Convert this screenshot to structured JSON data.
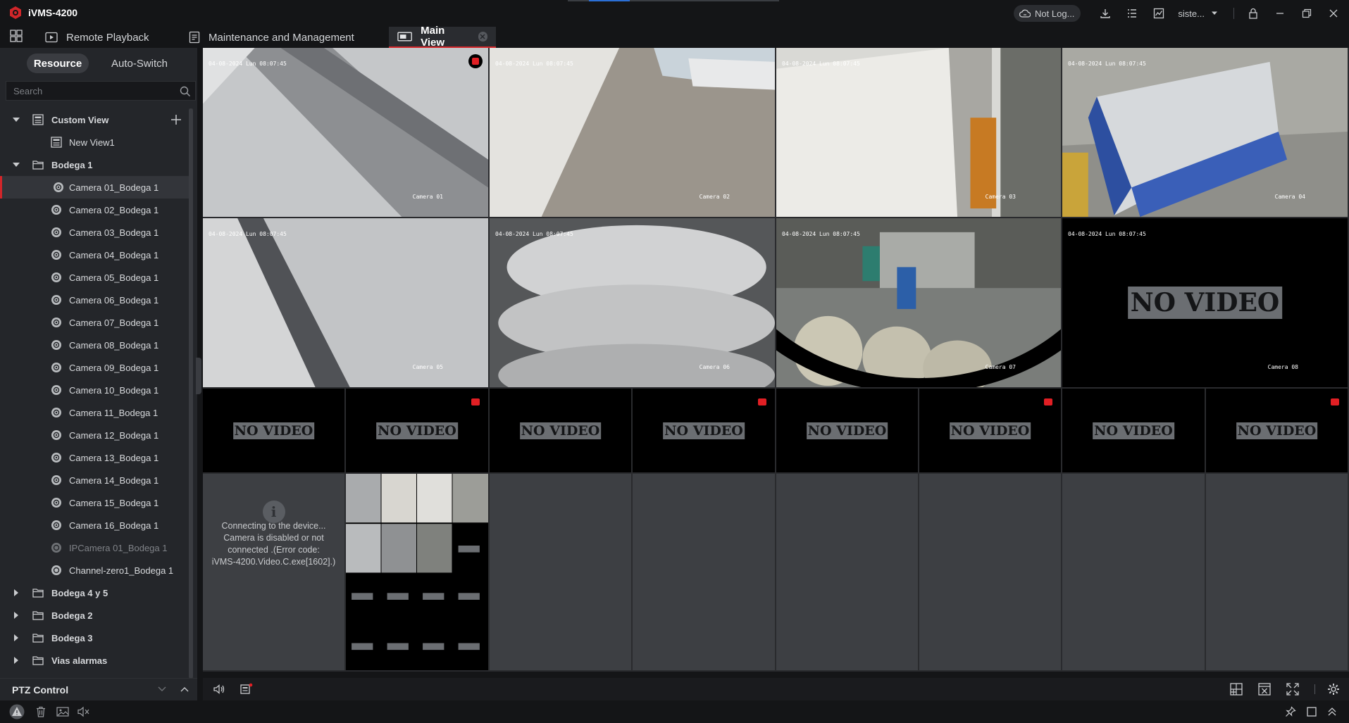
{
  "app": {
    "title": "iVMS-4200"
  },
  "titlebar": {
    "login_status": "Not Log...",
    "user": "siste..."
  },
  "tabs": [
    {
      "label": "Remote Playback"
    },
    {
      "label": "Maintenance and Management"
    },
    {
      "label": "Main View"
    }
  ],
  "sidebar": {
    "tabs": {
      "resource": "Resource",
      "auto_switch": "Auto-Switch"
    },
    "search_placeholder": "Search",
    "tree": {
      "custom_view": "Custom View",
      "new_view": "New View1",
      "bodega1": "Bodega 1",
      "cameras": [
        "Camera 01_Bodega 1",
        "Camera 02_Bodega 1",
        "Camera 03_Bodega 1",
        "Camera 04_Bodega 1",
        "Camera 05_Bodega 1",
        "Camera 06_Bodega 1",
        "Camera 07_Bodega 1",
        "Camera 08_Bodega 1",
        "Camera 09_Bodega 1",
        "Camera 10_Bodega 1",
        "Camera 11_Bodega 1",
        "Camera 12_Bodega 1",
        "Camera 13_Bodega 1",
        "Camera 14_Bodega 1",
        "Camera 15_Bodega 1",
        "Camera 16_Bodega 1"
      ],
      "ipcamera": "IPCamera 01_Bodega 1",
      "channel_zero": "Channel-zero1_Bodega 1",
      "groups": [
        "Bodega 4 y 5",
        "Bodega 2",
        "Bodega 3",
        "Vias alarmas"
      ]
    },
    "ptz": "PTZ Control"
  },
  "video": {
    "timestamp": "04-08-2024 Lun 08:07:45",
    "no_video": "NO VIDEO",
    "camera_labels": [
      "Camera 01",
      "Camera 02",
      "Camera 03",
      "Camera 04",
      "Camera 05",
      "Camera 06",
      "Camera 07",
      "Camera 08"
    ],
    "error_message": "Connecting to the device...\nCamera is disabled or not\nconnected .(Error code:\niVMS-4200.Video.C.exe[1602].)"
  },
  "colors": {
    "accent": "#d2262a",
    "background": "#141517",
    "panel": "#24262a",
    "empty_cell": "#3d3f43"
  }
}
